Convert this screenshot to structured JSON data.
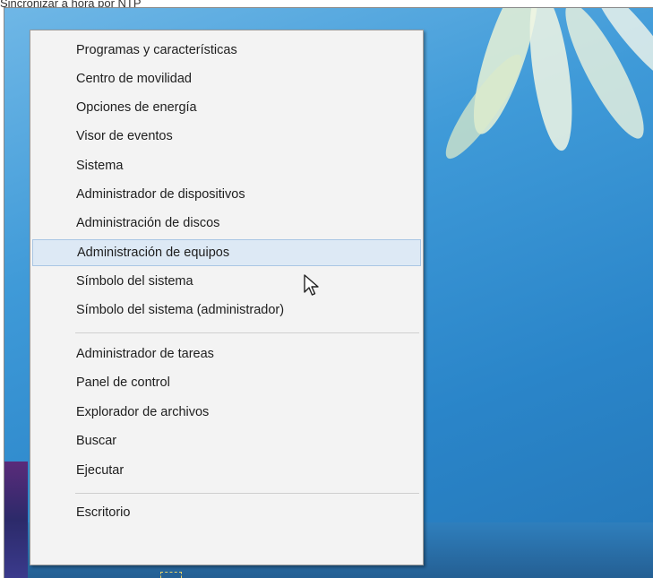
{
  "caption": "Sincronizar a hora por NTP",
  "menu": {
    "group1": [
      {
        "label": "Programas y características"
      },
      {
        "label": "Centro de movilidad"
      },
      {
        "label": "Opciones de energía"
      },
      {
        "label": "Visor de eventos"
      },
      {
        "label": "Sistema"
      },
      {
        "label": "Administrador de dispositivos"
      },
      {
        "label": "Administración de discos"
      },
      {
        "label": "Administración de equipos",
        "highlighted": true
      },
      {
        "label": "Símbolo del sistema"
      },
      {
        "label": "Símbolo del sistema (administrador)"
      }
    ],
    "group2": [
      {
        "label": "Administrador de tareas"
      },
      {
        "label": "Panel de control"
      },
      {
        "label": "Explorador de archivos"
      },
      {
        "label": "Buscar"
      },
      {
        "label": "Ejecutar"
      }
    ],
    "group3": [
      {
        "label": "Escritorio"
      }
    ]
  },
  "colors": {
    "desktop_background": "#3f9ad8",
    "menu_background": "#f3f3f3",
    "highlight_background": "#dde9f5",
    "highlight_border": "#a9c6e4"
  },
  "icons": {
    "cursor": "mouse-pointer-icon"
  }
}
